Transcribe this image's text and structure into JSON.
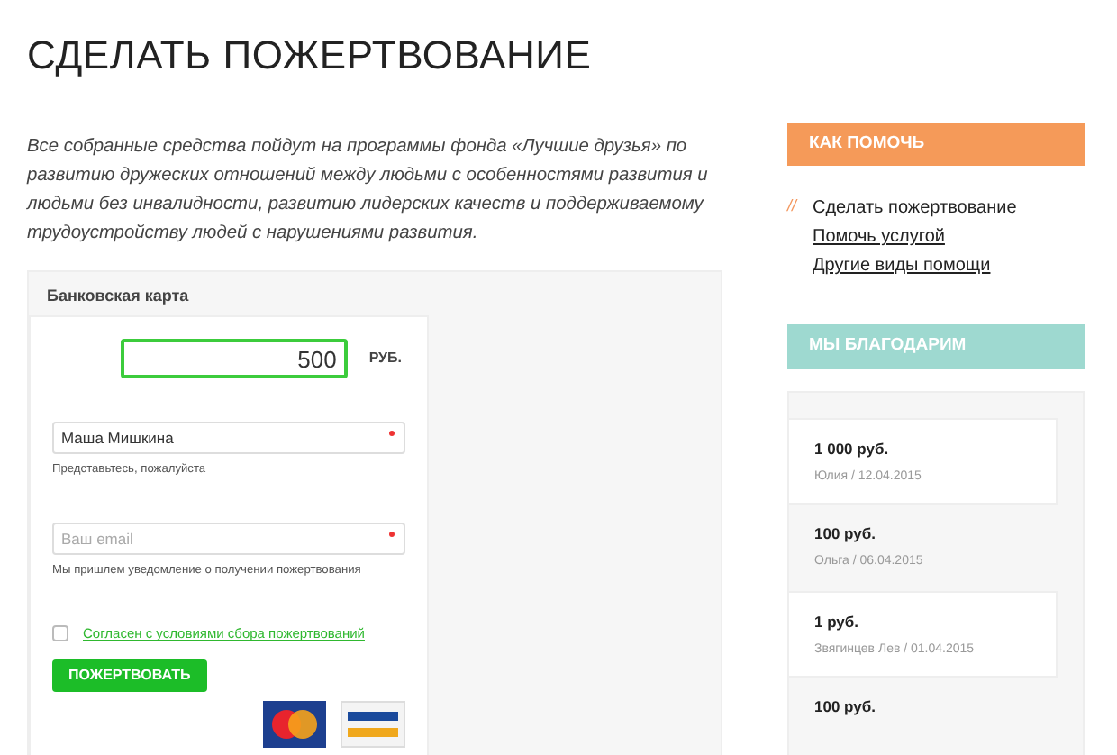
{
  "page_title": "СДЕЛАТЬ ПОЖЕРТВОВАНИЕ",
  "intro": "Все собранные средства пойдут на программы фонда «Лучшие друзья» по развитию дружеских отношений между людьми с особенностями развития и людьми без инвалидности, развитию лидерских качеств и поддерживаемому трудоустройству людей с нарушениями развития.",
  "form": {
    "tab": "Банковская карта",
    "amount": "500",
    "currency": "РУБ.",
    "fields": [
      {
        "value": "Маша Мишкина",
        "required": true,
        "hint": "Представьтесь, пожалуйста"
      },
      {
        "placeholder": "Ваш email",
        "required": true,
        "hint": "Мы пришлем уведомление о получении пожертвования"
      }
    ],
    "agree": {
      "label": "Согласен с условиями сбора пожертвований",
      "checked": false
    },
    "submit": "ПОЖЕРТВОВАТЬ"
  },
  "sidebar": {
    "help_title": "КАК ПОМОЧЬ",
    "help_items": [
      {
        "label": "Сделать пожертвование",
        "selected": true,
        "marker": "//"
      },
      {
        "label": "Помочь услугой",
        "selected": false
      },
      {
        "label": "Другие виды помощи",
        "selected": false
      }
    ],
    "thanks_title": "МЫ БЛАГОДАРИМ",
    "donations": [
      {
        "amount": "1 000 руб.",
        "meta": "Юлия / 12.04.2015",
        "boxed": true
      },
      {
        "amount": "100 руб.",
        "meta": "Ольга / 06.04.2015",
        "boxed": false
      },
      {
        "amount": "1 руб.",
        "meta": "Звягинцев Лев / 01.04.2015",
        "boxed": true
      },
      {
        "amount": "100 руб.",
        "boxed": false
      }
    ]
  }
}
